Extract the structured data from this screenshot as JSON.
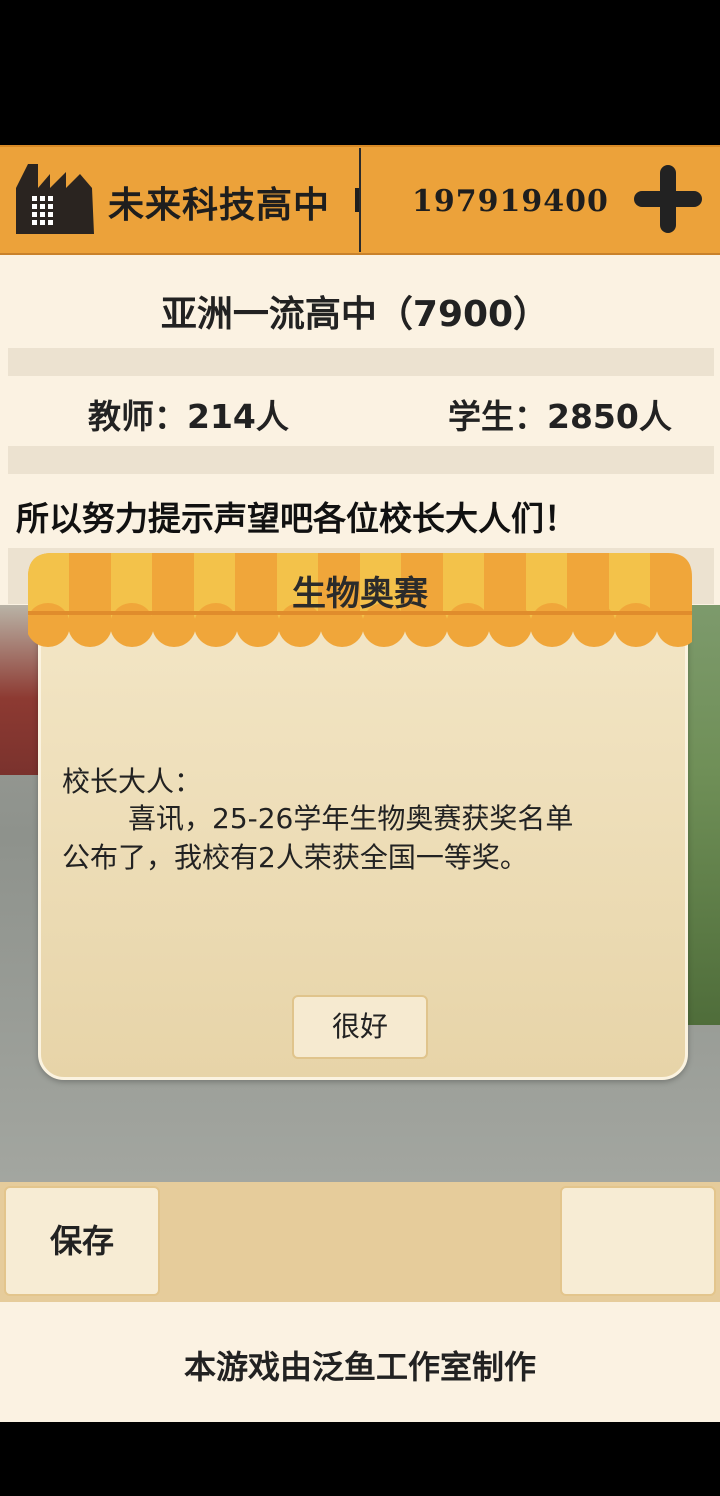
{
  "header": {
    "school_name": "未来科技高中",
    "money": "197919400",
    "factory_icon": "factory-icon",
    "plus_icon": "plus-icon"
  },
  "info": {
    "rank": "亚洲一流高中（7900）",
    "teachers": "教师：214人",
    "students": "学生：2850人",
    "notice": "所以努力提示声望吧各位校长大人们！"
  },
  "dialog": {
    "title": "生物奥赛",
    "greeting": "校长大人：",
    "line1": "喜讯，25-26学年生物奥赛获奖名单",
    "line2": "公布了，我校有2人荣获全国一等奖。",
    "ok_label": "很好"
  },
  "bottom": {
    "save_label": "保存"
  },
  "footer": {
    "credits": "本游戏由泛鱼工作室制作"
  },
  "colors": {
    "header_orange": "#eca23a",
    "panel_cream": "#fbf2e2",
    "dialog_beige": "#efdfb8",
    "awning_orange": "#f0a63a",
    "awning_yellow": "#f3c24a"
  }
}
